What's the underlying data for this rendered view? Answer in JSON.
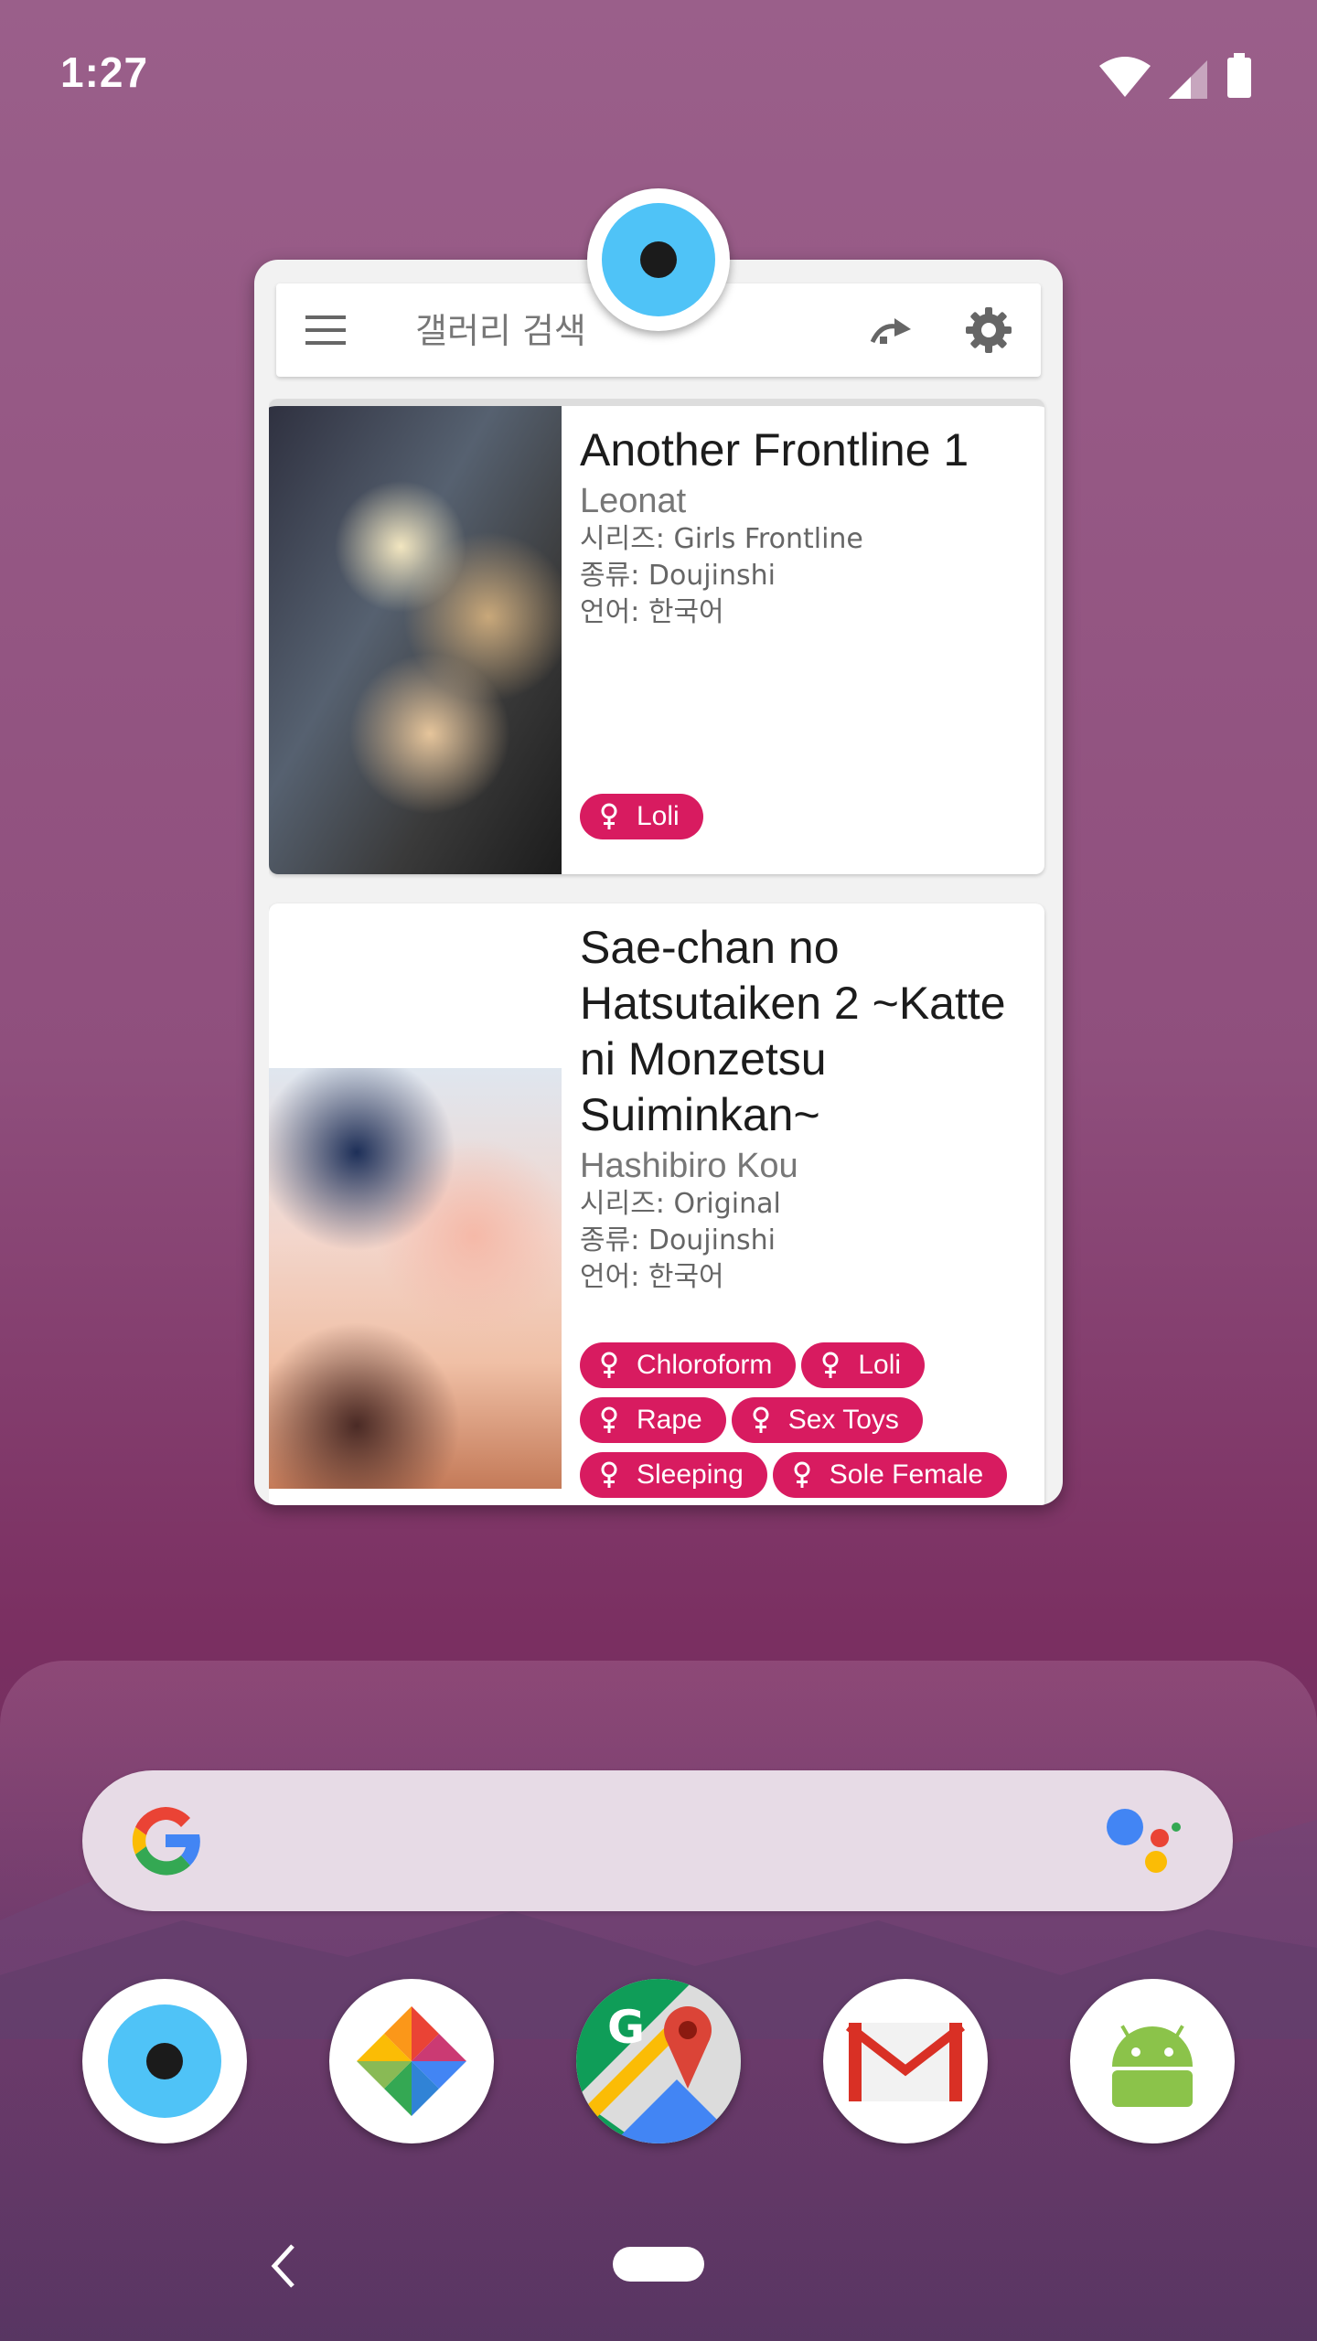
{
  "status_bar": {
    "time": "1:27"
  },
  "widget": {
    "search": {
      "placeholder": "갤러리 검색"
    },
    "cards": [
      {
        "title": "Another Frontline 1",
        "artist": "Leonat",
        "series": "시리즈: Girls Frontline",
        "type": "종류: Doujinshi",
        "language": "언어: 한국어",
        "tags": [
          "Loli"
        ]
      },
      {
        "title": "Sae-chan no Hatsutaiken 2 ~Katte ni Monzetsu Suiminkan~",
        "artist": "Hashibiro Kou",
        "series": "시리즈: Original",
        "type": "종류: Doujinshi",
        "language": "언어: 한국어",
        "tags": [
          "Chloroform",
          "Loli",
          "Rape",
          "Sex Toys",
          "Sleeping",
          "Sole Female"
        ]
      }
    ]
  },
  "colors": {
    "tag": "#d81b60",
    "eye_blue": "#4fc3f7"
  },
  "dock": {
    "apps": [
      "eye-app-icon",
      "photos-icon",
      "maps-icon",
      "gmail-icon",
      "android-icon"
    ]
  }
}
